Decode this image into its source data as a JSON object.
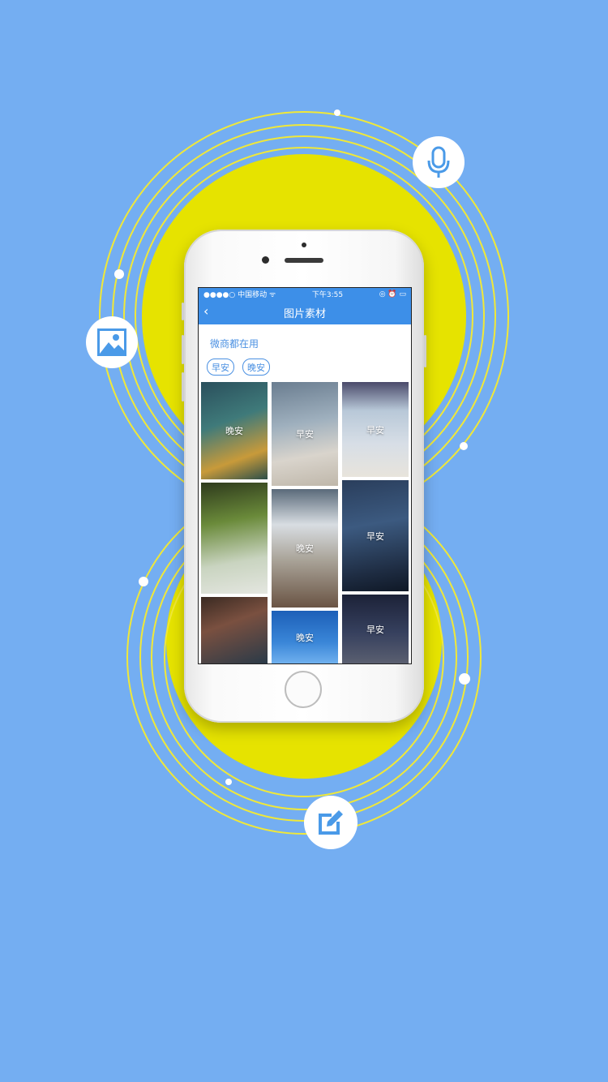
{
  "colors": {
    "background": "#74aef2",
    "circle_yellow": "#e6e300",
    "ring_yellow": "#f0e838",
    "accent_blue": "#3d8fe8"
  },
  "icons": {
    "microphone": "microphone-icon",
    "image": "image-icon",
    "edit": "edit-icon"
  },
  "phone": {
    "status": {
      "carrier": "●●●●○ 中国移动 ᯤ",
      "time": "下午3:55",
      "right": "◎ ⏰ ▭"
    },
    "nav": {
      "back": "‹",
      "title": "图片素材"
    },
    "subtitle": "微商都在用",
    "tags": [
      "早安",
      "晚安"
    ],
    "images": [
      {
        "label": "晚安"
      },
      {
        "label": "早安"
      },
      {
        "label": "早安"
      },
      {
        "label": ""
      },
      {
        "label": "晚安"
      },
      {
        "label": "早安"
      },
      {
        "label": ""
      },
      {
        "label": "晚安"
      },
      {
        "label": "早安"
      },
      {
        "label": ""
      }
    ]
  }
}
